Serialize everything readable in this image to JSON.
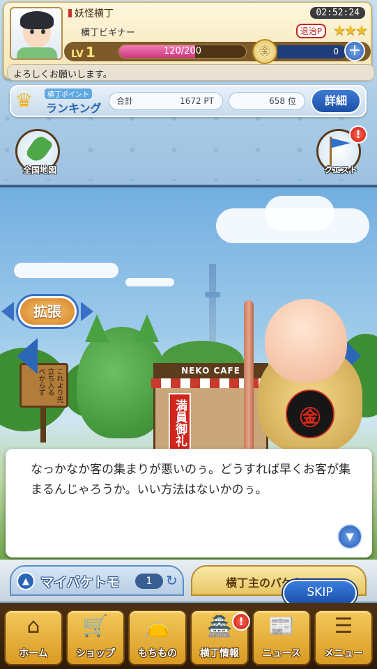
{
  "header": {
    "town_name": "妖怪横丁",
    "clock": "02:52:24",
    "rank_title": "横丁ビギナー",
    "taiji_label": "退治P",
    "stars": "★★★",
    "level_prefix": "LV",
    "level": "1",
    "xp_text": "120/200",
    "xp_progress": 0.6,
    "coin_symbol": "㊎",
    "coins": "0",
    "plus": "+",
    "greeting": "よろしくお願いします。"
  },
  "ranking": {
    "sub_label": "横丁ポイント",
    "title": "ランキング",
    "total_label": "合計",
    "points": "1672 PT",
    "rank": "658",
    "rank_unit": "位",
    "detail_button": "詳細"
  },
  "side_buttons": {
    "map_label": "全国地図",
    "quest_label": "クエスト",
    "quest_badge": "!"
  },
  "scene": {
    "expand_label": "拡張",
    "cafe_sign": "NEKO CAFE",
    "banner": "満員御礼",
    "signpost": "これより先 立ち入る べからず"
  },
  "dialog": {
    "text": "なっかなか客の集まりが悪いのぅ。どうすれば早くお客が集まるんじゃろうか。いい方法はないかのぅ。",
    "next_icon": "▼"
  },
  "tabs": {
    "left_icon": "▲",
    "left_label": "マイバケトモ",
    "left_count": "1",
    "left_reload": "↻",
    "right_label": "横丁主のバケトモ"
  },
  "skip_button": "SKIP",
  "nav": [
    {
      "label": "ホーム",
      "icon": "⌂",
      "icon_name": "home-icon"
    },
    {
      "label": "ショップ",
      "icon": "🛒",
      "icon_name": "cart-icon"
    },
    {
      "label": "もちもの",
      "icon": "👝",
      "icon_name": "bag-icon"
    },
    {
      "label": "横丁情報",
      "icon": "🏯",
      "icon_name": "shop-info-icon",
      "badge": "!"
    },
    {
      "label": "ニュース",
      "icon": "📰",
      "icon_name": "news-icon"
    },
    {
      "label": "メニュー",
      "icon": "☰",
      "icon_name": "menu-icon"
    }
  ]
}
